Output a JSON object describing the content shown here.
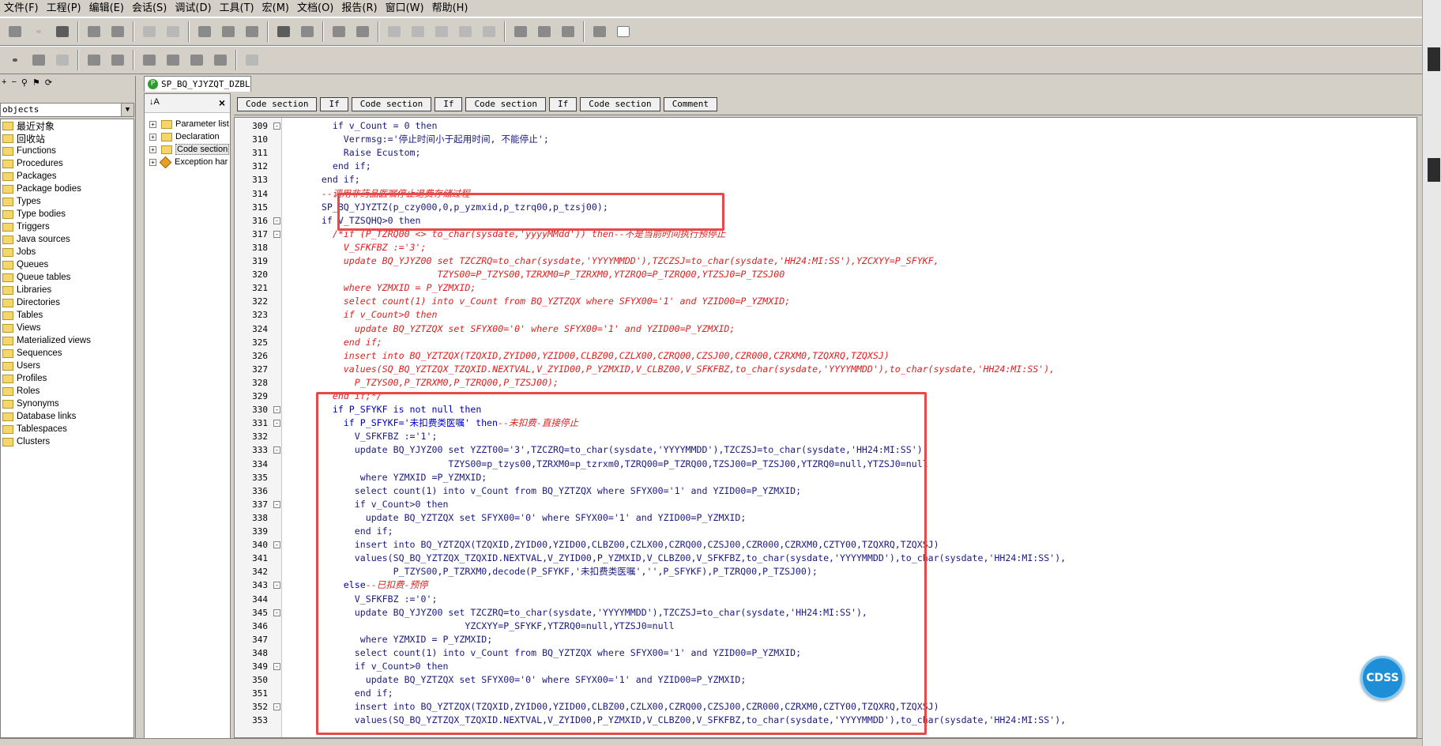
{
  "menu": [
    "文件(F)",
    "工程(P)",
    "编辑(E)",
    "会话(S)",
    "调试(D)",
    "工具(T)",
    "宏(M)",
    "文档(O)",
    "报告(R)",
    "窗口(W)",
    "帮助(H)"
  ],
  "objects_panel": {
    "selector_value": "objects",
    "items": [
      "最近对象",
      "回收站",
      "Functions",
      "Procedures",
      "Packages",
      "Package bodies",
      "Types",
      "Type bodies",
      "Triggers",
      "Java sources",
      "Jobs",
      "Queues",
      "Queue tables",
      "Libraries",
      "Directories",
      "Tables",
      "Views",
      "Materialized views",
      "Sequences",
      "Users",
      "Profiles",
      "Roles",
      "Synonyms",
      "Database links",
      "Tablespaces",
      "Clusters"
    ]
  },
  "editor_tab": {
    "label": "SP_BQ_YJYZQT_DZBL",
    "badge": "P"
  },
  "outline": {
    "items": [
      "Parameter list",
      "Declaration",
      "Code section",
      "Exception har"
    ]
  },
  "section_buttons": [
    "Code section",
    "If",
    "Code section",
    "If",
    "Code section",
    "If",
    "Code section",
    "Comment"
  ],
  "code_lines": [
    {
      "n": "309",
      "fold": "-",
      "segs": [
        {
          "t": "        if v_Count = 0 then",
          "c": "navy"
        }
      ]
    },
    {
      "n": "310",
      "fold": "",
      "segs": [
        {
          "t": "          Verrmsg:='停止时间小于起用时间, 不能停止';",
          "c": "navy"
        }
      ]
    },
    {
      "n": "311",
      "fold": "",
      "segs": [
        {
          "t": "          Raise Ecustom;",
          "c": "navy"
        }
      ]
    },
    {
      "n": "312",
      "fold": "",
      "segs": [
        {
          "t": "        end if;",
          "c": "navy"
        }
      ]
    },
    {
      "n": "313",
      "fold": "",
      "segs": [
        {
          "t": "      end if;",
          "c": "navy"
        }
      ]
    },
    {
      "n": "314",
      "fold": "",
      "segs": [
        {
          "t": "      --调用非药品医嘱停止退费存储过程",
          "c": "red"
        }
      ]
    },
    {
      "n": "315",
      "fold": "",
      "segs": [
        {
          "t": "      SP_BQ_YJYZTZ(p_czy000,0,p_yzmxid,p_tzrq00,p_tzsj00);",
          "c": "navy"
        }
      ]
    },
    {
      "n": "316",
      "fold": "-",
      "segs": [
        {
          "t": "      if V_TZSQHQ>0 then",
          "c": "navy"
        }
      ]
    },
    {
      "n": "317",
      "fold": "-",
      "segs": [
        {
          "t": "        /*if (P_TZRQ00 <> to_char(sysdate,'yyyyMMdd')) then--不是当前时间执行预停止",
          "c": "red"
        }
      ]
    },
    {
      "n": "318",
      "fold": "",
      "segs": [
        {
          "t": "          V_SFKFBZ :='3';",
          "c": "red"
        }
      ]
    },
    {
      "n": "319",
      "fold": "",
      "segs": [
        {
          "t": "          update BQ_YJYZ00 set TZCZRQ=to_char(sysdate,'YYYYMMDD'),TZCZSJ=to_char(sysdate,'HH24:MI:SS'),YZCXYY=P_SFYKF,",
          "c": "red"
        }
      ]
    },
    {
      "n": "320",
      "fold": "",
      "segs": [
        {
          "t": "                           TZYS00=P_TZYS00,TZRXM0=P_TZRXM0,YTZRQ0=P_TZRQ00,YTZSJ0=P_TZSJ00",
          "c": "red"
        }
      ]
    },
    {
      "n": "321",
      "fold": "",
      "segs": [
        {
          "t": "          where YZMXID = P_YZMXID;",
          "c": "red"
        }
      ]
    },
    {
      "n": "322",
      "fold": "",
      "segs": [
        {
          "t": "          select count(1) into v_Count from BQ_YZTZQX where SFYX00='1' and YZID00=P_YZMXID;",
          "c": "red"
        }
      ]
    },
    {
      "n": "323",
      "fold": "",
      "segs": [
        {
          "t": "          if v_Count>0 then",
          "c": "red"
        }
      ]
    },
    {
      "n": "324",
      "fold": "",
      "segs": [
        {
          "t": "            update BQ_YZTZQX set SFYX00='0' where SFYX00='1' and YZID00=P_YZMXID;",
          "c": "red"
        }
      ]
    },
    {
      "n": "325",
      "fold": "",
      "segs": [
        {
          "t": "          end if;",
          "c": "red"
        }
      ]
    },
    {
      "n": "326",
      "fold": "",
      "segs": [
        {
          "t": "          insert into BQ_YZTZQX(TZQXID,ZYID00,YZID00,CLBZ00,CZLX00,CZRQ00,CZSJ00,CZR000,CZRXM0,TZQXRQ,TZQXSJ)",
          "c": "red"
        }
      ]
    },
    {
      "n": "327",
      "fold": "",
      "segs": [
        {
          "t": "          values(SQ_BQ_YZTZQX_TZQXID.NEXTVAL,V_ZYID00,P_YZMXID,V_CLBZ00,V_SFKFBZ,to_char(sysdate,'YYYYMMDD'),to_char(sysdate,'HH24:MI:SS'),",
          "c": "red"
        }
      ]
    },
    {
      "n": "328",
      "fold": "",
      "segs": [
        {
          "t": "            P_TZYS00,P_TZRXM0,P_TZRQ00,P_TZSJ00);",
          "c": "red"
        }
      ]
    },
    {
      "n": "329",
      "fold": "",
      "segs": [
        {
          "t": "        end if;*/",
          "c": "red"
        }
      ]
    },
    {
      "n": "330",
      "fold": "-",
      "segs": [
        {
          "t": "        if P_SFYKF is not null then",
          "c": "blue"
        }
      ]
    },
    {
      "n": "331",
      "fold": "-",
      "segs": [
        {
          "t": "          if P_SFYKF='未扣费类医嘱' then",
          "c": "blue"
        },
        {
          "t": "--未扣费-直接停止",
          "c": "red"
        }
      ]
    },
    {
      "n": "332",
      "fold": "",
      "segs": [
        {
          "t": "            V_SFKFBZ :='1';",
          "c": "navy"
        }
      ]
    },
    {
      "n": "333",
      "fold": "-",
      "segs": [
        {
          "t": "            update BQ_YJYZ00 set YZZT00='3',TZCZRQ=to_char(sysdate,'YYYYMMDD'),TZCZSJ=to_char(sysdate,'HH24:MI:SS'),",
          "c": "navy"
        }
      ]
    },
    {
      "n": "334",
      "fold": "",
      "segs": [
        {
          "t": "                             TZYS00=p_tzys00,TZRXM0=p_tzrxm0,TZRQ00=P_TZRQ00,TZSJ00=P_TZSJ00,YTZRQ0=null,YTZSJ0=null",
          "c": "navy"
        }
      ]
    },
    {
      "n": "335",
      "fold": "",
      "segs": [
        {
          "t": "             where YZMXID =P_YZMXID;",
          "c": "navy"
        }
      ]
    },
    {
      "n": "336",
      "fold": "",
      "segs": [
        {
          "t": "            select count(1) into v_Count from BQ_YZTZQX where SFYX00='1' and YZID00=P_YZMXID;",
          "c": "navy"
        }
      ]
    },
    {
      "n": "337",
      "fold": "-",
      "segs": [
        {
          "t": "            if v_Count>0 then",
          "c": "navy"
        }
      ]
    },
    {
      "n": "338",
      "fold": "",
      "segs": [
        {
          "t": "              update BQ_YZTZQX set SFYX00='0' where SFYX00='1' and YZID00=P_YZMXID;",
          "c": "navy"
        }
      ]
    },
    {
      "n": "339",
      "fold": "",
      "segs": [
        {
          "t": "            end if;",
          "c": "navy"
        }
      ]
    },
    {
      "n": "340",
      "fold": "-",
      "segs": [
        {
          "t": "            insert into BQ_YZTZQX(TZQXID,ZYID00,YZID00,CLBZ00,CZLX00,CZRQ00,CZSJ00,CZR000,CZRXM0,CZTY00,TZQXRQ,TZQXSJ)",
          "c": "navy"
        }
      ]
    },
    {
      "n": "341",
      "fold": "",
      "segs": [
        {
          "t": "            values(SQ_BQ_YZTZQX_TZQXID.NEXTVAL,V_ZYID00,P_YZMXID,V_CLBZ00,V_SFKFBZ,to_char(sysdate,'YYYYMMDD'),to_char(sysdate,'HH24:MI:SS'),",
          "c": "navy"
        }
      ]
    },
    {
      "n": "342",
      "fold": "",
      "segs": [
        {
          "t": "                   P_TZYS00,P_TZRXM0,decode(P_SFYKF,'未扣费类医嘱','',P_SFYKF),P_TZRQ00,P_TZSJ00);",
          "c": "navy"
        }
      ]
    },
    {
      "n": "343",
      "fold": "-",
      "segs": [
        {
          "t": "          else",
          "c": "blue"
        },
        {
          "t": "--已扣费-预停",
          "c": "red"
        }
      ]
    },
    {
      "n": "344",
      "fold": "",
      "segs": [
        {
          "t": "            V_SFKFBZ :='0';",
          "c": "navy"
        }
      ]
    },
    {
      "n": "345",
      "fold": "-",
      "segs": [
        {
          "t": "            update BQ_YJYZ00 set TZCZRQ=to_char(sysdate,'YYYYMMDD'),TZCZSJ=to_char(sysdate,'HH24:MI:SS'),",
          "c": "navy"
        }
      ]
    },
    {
      "n": "346",
      "fold": "",
      "segs": [
        {
          "t": "                                YZCXYY=P_SFYKF,YTZRQ0=null,YTZSJ0=null",
          "c": "navy"
        }
      ]
    },
    {
      "n": "347",
      "fold": "",
      "segs": [
        {
          "t": "             where YZMXID = P_YZMXID;",
          "c": "navy"
        }
      ]
    },
    {
      "n": "348",
      "fold": "",
      "segs": [
        {
          "t": "            select count(1) into v_Count from BQ_YZTZQX where SFYX00='1' and YZID00=P_YZMXID;",
          "c": "navy"
        }
      ]
    },
    {
      "n": "349",
      "fold": "-",
      "segs": [
        {
          "t": "            if v_Count>0 then",
          "c": "navy"
        }
      ]
    },
    {
      "n": "350",
      "fold": "",
      "segs": [
        {
          "t": "              update BQ_YZTZQX set SFYX00='0' where SFYX00='1' and YZID00=P_YZMXID;",
          "c": "navy"
        }
      ]
    },
    {
      "n": "351",
      "fold": "",
      "segs": [
        {
          "t": "            end if;",
          "c": "navy"
        }
      ]
    },
    {
      "n": "352",
      "fold": "-",
      "segs": [
        {
          "t": "            insert into BQ_YZTZQX(TZQXID,ZYID00,YZID00,CLBZ00,CZLX00,CZRQ00,CZSJ00,CZR000,CZRXM0,CZTY00,TZQXRQ,TZQXSJ)",
          "c": "navy"
        }
      ]
    },
    {
      "n": "353",
      "fold": "",
      "segs": [
        {
          "t": "            values(SQ_BQ_YZTZQX_TZQXID.NEXTVAL,V_ZYID00,P_YZMXID,V_CLBZ00,V_SFKFBZ,to_char(sysdate,'YYYYMMDD'),to_char(sysdate,'HH24:MI:SS'),",
          "c": "navy"
        }
      ]
    }
  ],
  "floating_badge": "CDSS",
  "colors": {
    "highlight": "#e84848",
    "keyword": "#0000c8",
    "comment": "#e02020",
    "code": "#1a1a80"
  }
}
